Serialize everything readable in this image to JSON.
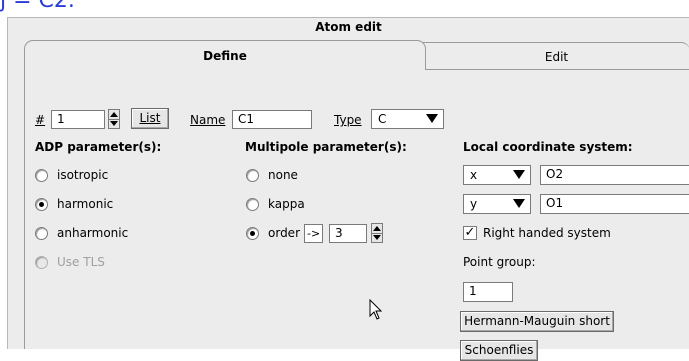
{
  "background_fragment": "j  = C2.",
  "window": {
    "title": "Atom edit"
  },
  "tabs": [
    {
      "label": "Define"
    },
    {
      "label": "Edit"
    }
  ],
  "atom": {
    "number_label": "#",
    "number_value": "1",
    "list_button": "List",
    "name_label": "Name",
    "name_value": "C1",
    "type_label": "Type",
    "type_value": "C"
  },
  "adp": {
    "header": "ADP parameter(s):",
    "options": [
      {
        "label": "isotropic",
        "selected": false
      },
      {
        "label": "harmonic",
        "selected": true
      },
      {
        "label": "anharmonic",
        "selected": false
      },
      {
        "label": "Use TLS",
        "selected": false,
        "disabled": true
      }
    ]
  },
  "multipole": {
    "header": "Multipole parameter(s):",
    "options": [
      {
        "label": "none",
        "selected": false
      },
      {
        "label": "kappa",
        "selected": false
      },
      {
        "label": "order",
        "selected": true
      }
    ],
    "order_arrow": "->",
    "order_value": "3"
  },
  "local_coords": {
    "header": "Local coordinate system:",
    "axis1_value": "x",
    "axis1_atom": "O2",
    "axis2_value": "y",
    "axis2_atom": "O1",
    "right_handed_label": "Right handed system",
    "right_handed_checked": true,
    "check_glyph": "✓"
  },
  "point_group": {
    "label": "Point group:",
    "value": "1",
    "hm_button": "Hermann-Mauguin short",
    "schoenflies_button": "Schoenflies"
  }
}
